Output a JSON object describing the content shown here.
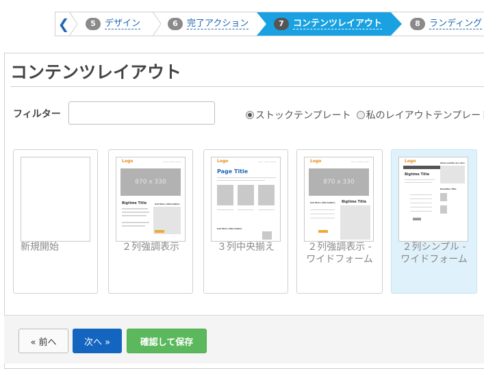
{
  "wizard": {
    "back_icon": "chevron-left-icon",
    "steps": [
      {
        "num": "5",
        "label": "デザイン"
      },
      {
        "num": "6",
        "label": "完了アクション"
      },
      {
        "num": "7",
        "label": "コンテンツレイアウト"
      },
      {
        "num": "8",
        "label": "ランディング"
      }
    ],
    "active_step": "7",
    "active_color": "#1aa1e1"
  },
  "panel": {
    "title": "コンテンツレイアウト"
  },
  "filter": {
    "label": "フィルター",
    "value": "",
    "radios": [
      {
        "label": "ストックテンプレート",
        "checked": true
      },
      {
        "label": "私のレイアウトテンプレート",
        "checked": false
      }
    ]
  },
  "templates": [
    {
      "label": "新規開始",
      "selected": false
    },
    {
      "label": "２列強調表示",
      "selected": false,
      "hero": "870 x 330",
      "heading": "Bigtime Title",
      "side_heading": "Get More Information"
    },
    {
      "label": "３列中央揃え",
      "selected": false,
      "heading": "Page Title",
      "sub_heading": "Get More Information"
    },
    {
      "label": "２列強調表示 -",
      "label2": "ワイドフォーム",
      "selected": false,
      "hero": "870 x 330",
      "heading": "Bigtime Title",
      "side_heading": "Get More Information"
    },
    {
      "label": "２列シンプル -",
      "label2": "ワイドフォーム",
      "selected": true,
      "heading": "Bigtime Title",
      "side_heading": "Some points are nice",
      "side_heading2": "Headline Title"
    }
  ],
  "footer": {
    "prev_label": "« 前へ",
    "next_label": "次へ »",
    "save_label": "確認して保存"
  },
  "colors": {
    "next_button": "#1465c0",
    "save_button": "#5cb85c",
    "selected_card": "#dff1fa"
  }
}
